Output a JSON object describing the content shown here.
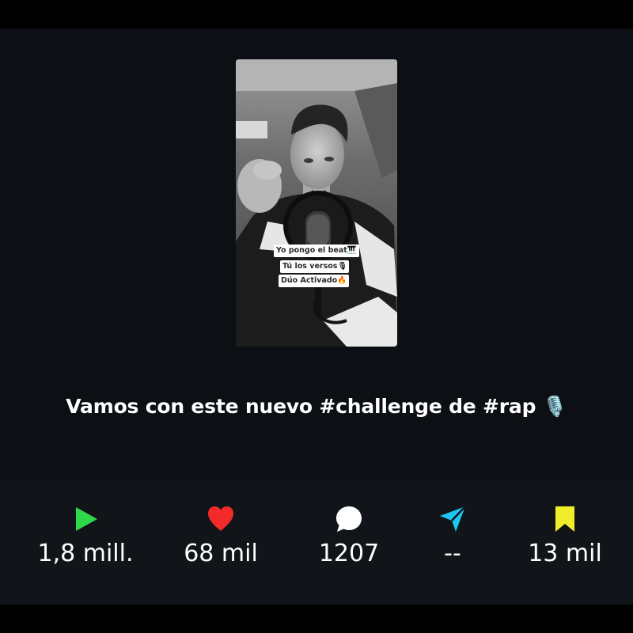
{
  "post": {
    "stickers": [
      "Yo pongo el beat🎹",
      "Tú los versos🎙",
      "Dúo Activado🔥"
    ],
    "caption": "Vamos con este nuevo #challenge de #rap 🎙️"
  },
  "stats": [
    {
      "id": "plays",
      "icon": "play-icon",
      "color": "#2fd84a",
      "value": "1,8 mill."
    },
    {
      "id": "likes",
      "icon": "heart-icon",
      "color": "#f22a2a",
      "value": "68 mil"
    },
    {
      "id": "comments",
      "icon": "comment-icon",
      "color": "#ffffff",
      "value": "1207"
    },
    {
      "id": "shares",
      "icon": "share-icon",
      "color": "#1ec6ef",
      "value": "--"
    },
    {
      "id": "saves",
      "icon": "bookmark-icon",
      "color": "#f0ee2a",
      "value": "13 mil"
    }
  ]
}
